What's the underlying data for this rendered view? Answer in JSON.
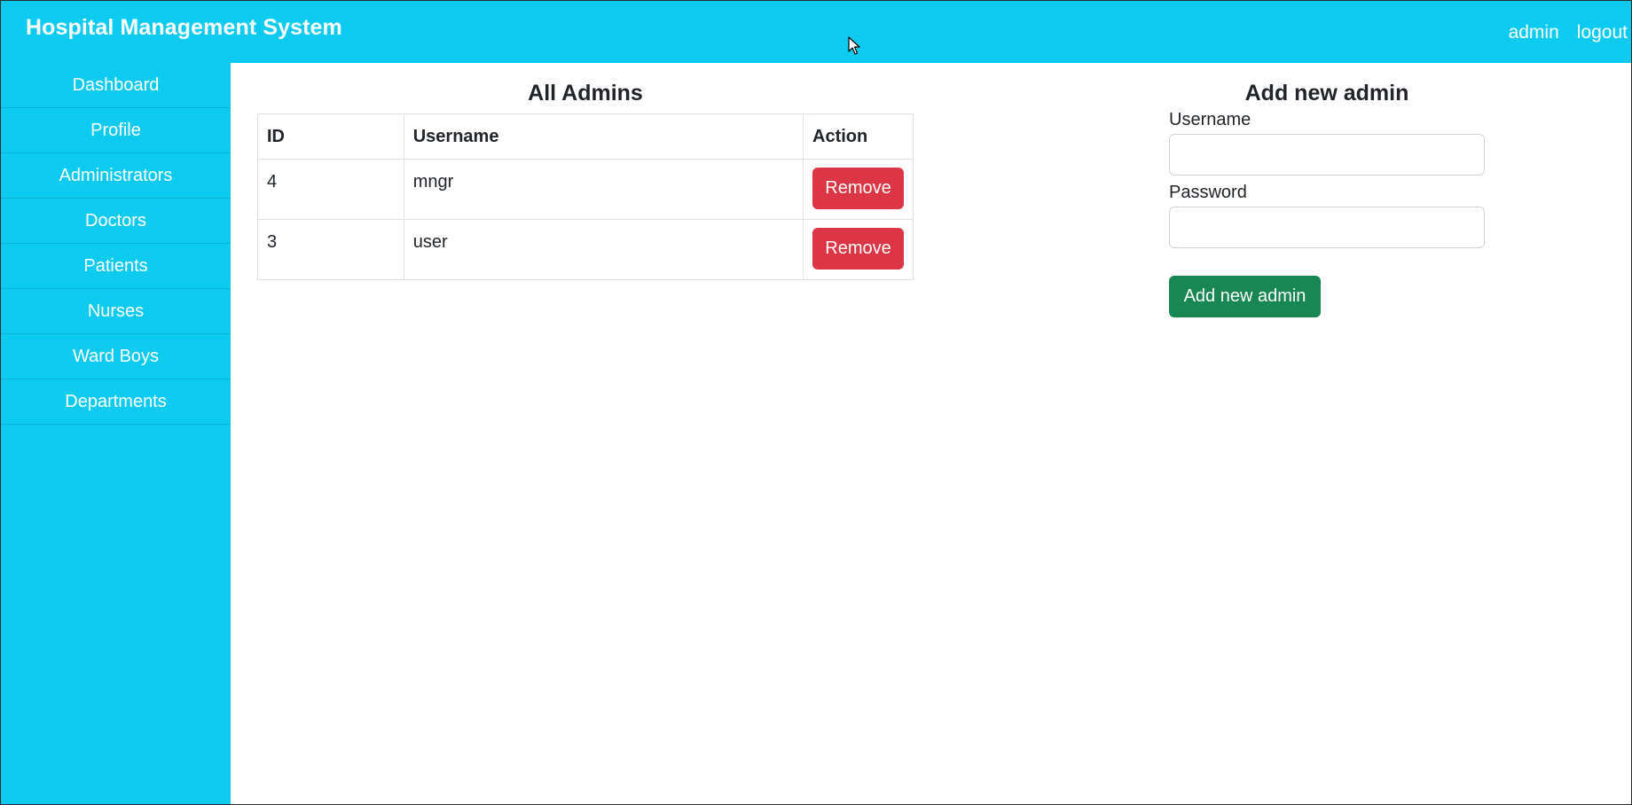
{
  "header": {
    "brand": "Hospital Management System",
    "user_link": "admin",
    "logout_link": "logout"
  },
  "sidebar": {
    "items": [
      {
        "label": "Dashboard"
      },
      {
        "label": "Profile"
      },
      {
        "label": "Administrators"
      },
      {
        "label": "Doctors"
      },
      {
        "label": "Patients"
      },
      {
        "label": "Nurses"
      },
      {
        "label": "Ward Boys"
      },
      {
        "label": "Departments"
      }
    ]
  },
  "admins": {
    "title": "All Admins",
    "columns": [
      "ID",
      "Username",
      "Action"
    ],
    "rows": [
      {
        "id": "4",
        "username": "mngr",
        "action": "Remove"
      },
      {
        "id": "3",
        "username": "user",
        "action": "Remove"
      }
    ]
  },
  "add_form": {
    "title": "Add new admin",
    "username_label": "Username",
    "username_value": "",
    "password_label": "Password",
    "password_value": "",
    "submit_label": "Add new admin"
  },
  "colors": {
    "primary_cyan": "#0dcaf0",
    "danger": "#dc3545",
    "success": "#198754"
  },
  "icons": {
    "cursor": "mouse-pointer-icon"
  }
}
